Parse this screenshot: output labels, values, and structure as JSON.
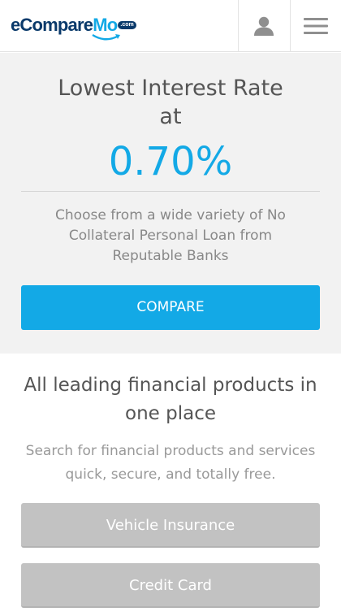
{
  "header": {
    "logo_main": "eCompare",
    "logo_accent": "Mo",
    "logo_suffix": ".com",
    "user_icon": "user-icon",
    "menu_icon": "hamburger-menu-icon"
  },
  "hero": {
    "title": "Lowest Interest Rate at",
    "rate": "0.70%",
    "description": "Choose from a wide variety of No Collateral Personal Loan from Reputable Banks",
    "cta_label": "COMPARE"
  },
  "products": {
    "title": "All leading financial products in one place",
    "description": "Search for financial products and services quick, secure, and totally free.",
    "buttons": [
      {
        "label": "Vehicle Insurance"
      },
      {
        "label": "Credit Card"
      }
    ]
  },
  "colors": {
    "accent": "#13a9e6",
    "brand_dark": "#0a3a6b",
    "hero_bg": "#f2f2f2",
    "product_button": "#c2c2c2"
  }
}
